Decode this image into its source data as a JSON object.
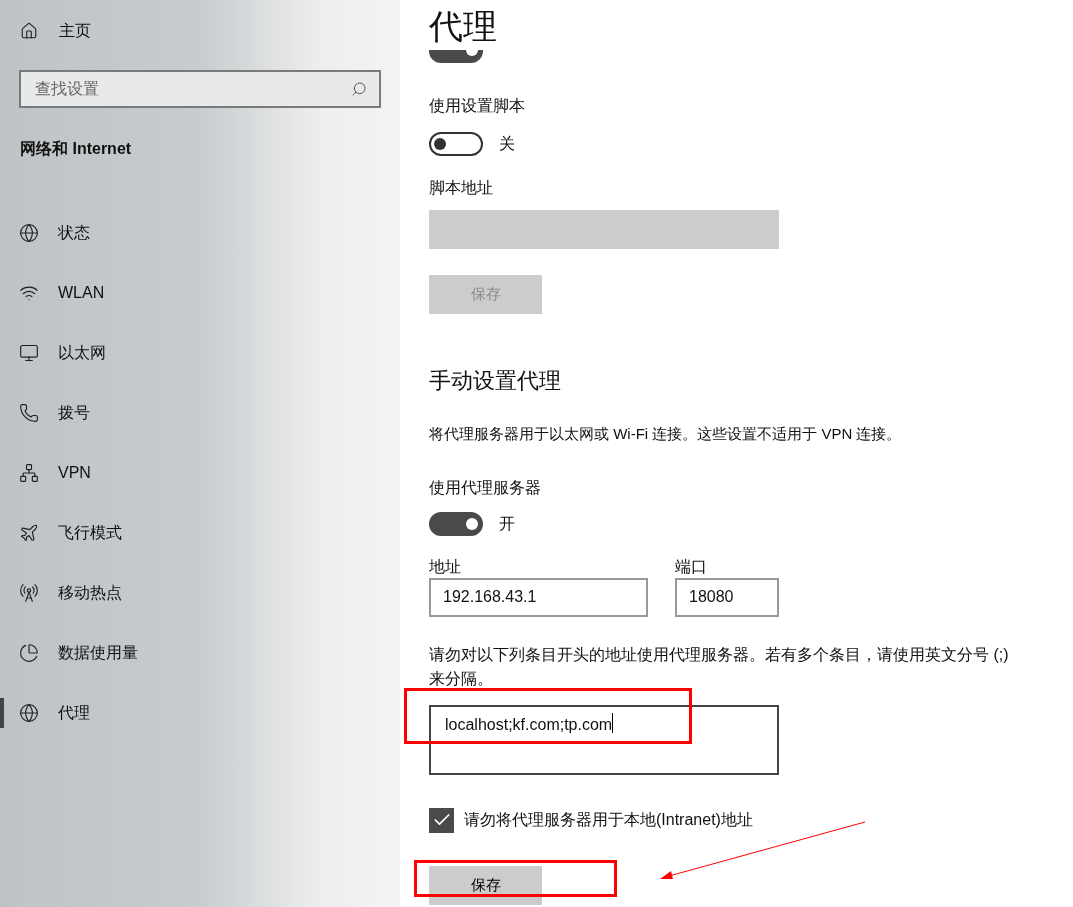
{
  "sidebar": {
    "home": "主页",
    "search": {
      "placeholder": "查找设置"
    },
    "heading": "网络和 Internet",
    "items": [
      {
        "label": "状态",
        "selected": false
      },
      {
        "label": "WLAN",
        "selected": false
      },
      {
        "label": "以太网",
        "selected": false
      },
      {
        "label": "拨号",
        "selected": false
      },
      {
        "label": "VPN",
        "selected": false
      },
      {
        "label": "飞行模式",
        "selected": false
      },
      {
        "label": "移动热点",
        "selected": false
      },
      {
        "label": "数据使用量",
        "selected": false
      },
      {
        "label": "代理",
        "selected": true
      }
    ]
  },
  "main": {
    "title": "代理",
    "auto_detect_toggle": {
      "on": true
    },
    "script": {
      "label": "使用设置脚本",
      "toggle": {
        "on": false,
        "text": "关"
      },
      "address_label": "脚本地址",
      "save": {
        "label": "保存",
        "disabled": true
      }
    },
    "manual": {
      "heading": "手动设置代理",
      "description": "将代理服务器用于以太网或 Wi-Fi 连接。这些设置不适用于 VPN 连接。",
      "use_label": "使用代理服务器",
      "toggle": {
        "on": true,
        "text": "开"
      },
      "address": {
        "label": "地址",
        "value": "192.168.43.1"
      },
      "port": {
        "label": "端口",
        "value": "18080"
      },
      "exceptions_text": "请勿对以下列条目开头的地址使用代理服务器。若有多个条目，请使用英文分号 (;) 来分隔。",
      "exceptions_value": "localhost;kf.com;tp.com",
      "local_checkbox": {
        "label": "请勿将代理服务器用于本地(Intranet)地址",
        "checked": true
      },
      "save": {
        "label": "保存",
        "disabled": false
      }
    }
  }
}
